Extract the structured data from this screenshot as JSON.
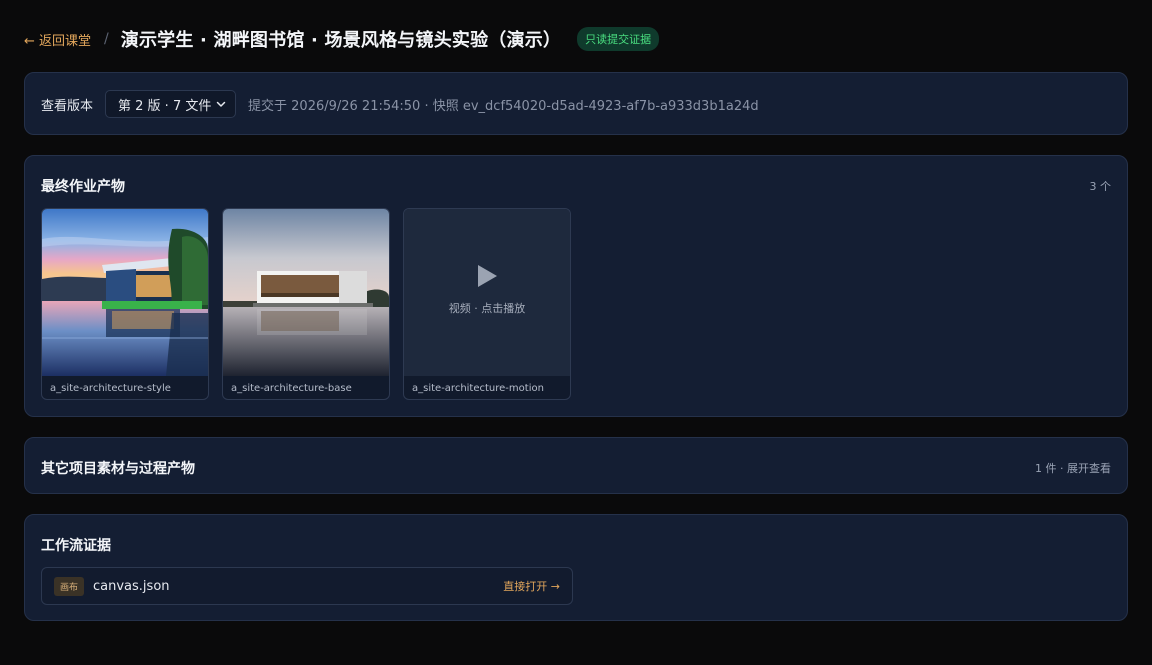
{
  "header": {
    "back_label": "← 返回课堂",
    "separator": "/",
    "title": "演示学生 · 湖畔图书馆 · 场景风格与镜头实验（演示）",
    "badge": "只读提交证据"
  },
  "version": {
    "label": "查看版本",
    "selected": "第 2 版 · 7 文件",
    "meta": "提交于 2026/9/26 21:54:50 · 快照 ev_dcf54020-d5ad-4923-af7b-a933d3b1a24d"
  },
  "final_outputs": {
    "title": "最终作业产物",
    "count": "3 个",
    "items": [
      {
        "caption": "a_site-architecture-style",
        "kind": "image"
      },
      {
        "caption": "a_site-architecture-base",
        "kind": "image"
      },
      {
        "caption": "a_site-architecture-motion",
        "kind": "video",
        "placeholder": "视频 · 点击播放"
      }
    ]
  },
  "other_materials": {
    "title": "其它项目素材与过程产物",
    "summary": "1 件 · 展开查看"
  },
  "workflow": {
    "title": "工作流证据",
    "items": [
      {
        "tag": "画布",
        "name": "canvas.json",
        "action": "直接打开 →"
      }
    ]
  },
  "colors": {
    "accent": "#e3a75c",
    "badge_text": "#4ade80",
    "card_bg": "#141e33",
    "page_bg": "#0a0a0b"
  },
  "icons": {
    "select": "chevron-down-icon",
    "video": "play-icon"
  }
}
